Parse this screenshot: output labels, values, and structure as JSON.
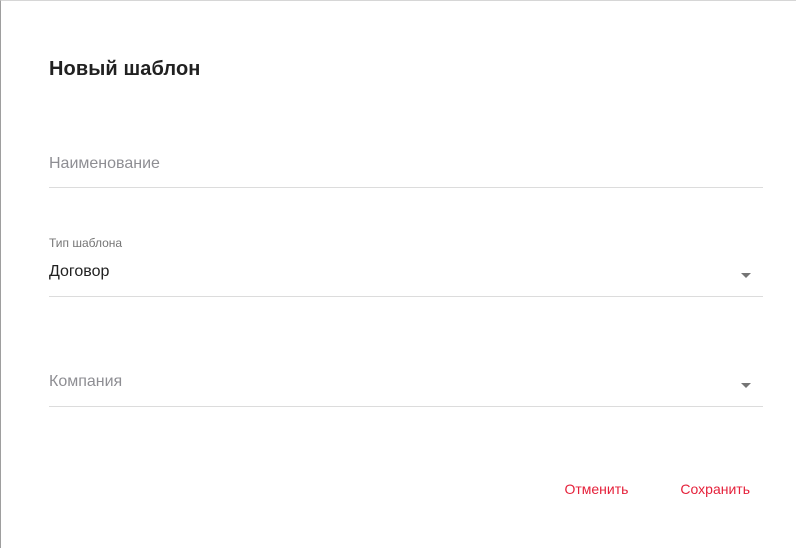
{
  "dialog": {
    "title": "Новый шаблон"
  },
  "fields": {
    "name": {
      "placeholder": "Наименование",
      "value": ""
    },
    "template_type": {
      "label": "Тип шаблона",
      "value": "Договор"
    },
    "company": {
      "placeholder": "Компания",
      "value": ""
    }
  },
  "actions": {
    "cancel_label": "Отменить",
    "save_label": "Сохранить"
  },
  "colors": {
    "accent": "#e5203a",
    "text": "#212121",
    "muted": "#8e8e93",
    "divider": "#dcdcdc"
  },
  "icons": {
    "dropdown": "caret-down-icon"
  }
}
